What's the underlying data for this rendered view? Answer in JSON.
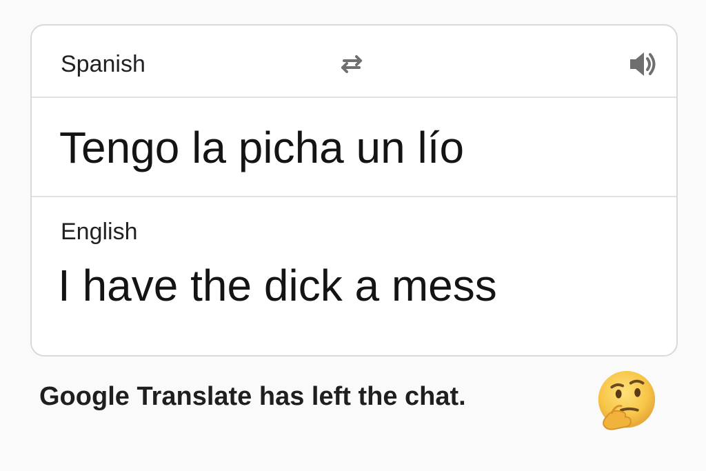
{
  "translator": {
    "source_language": "Spanish",
    "target_language": "English",
    "source_text": "Tengo la picha un lío",
    "translated_text": "I have the dick a mess",
    "swap_icon": "swap-languages-icon",
    "speaker_icon": "speaker-icon"
  },
  "caption": {
    "text": "Google Translate has left the chat.",
    "emoji_icon": "thinking-face-emoji"
  },
  "colors": {
    "background": "#fafafa",
    "card_border": "#d9d9d9",
    "icon_gray": "#6f6f6f",
    "text": "#1f1f1f",
    "emoji_yellow": "#f7c548"
  }
}
